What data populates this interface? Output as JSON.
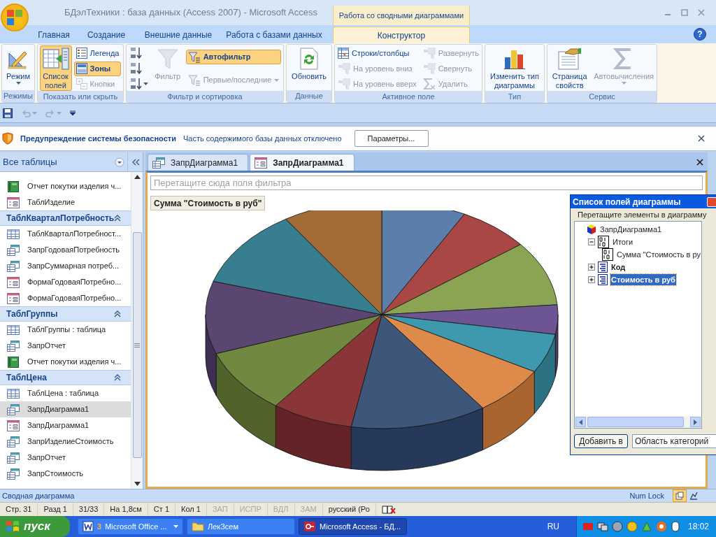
{
  "window": {
    "title": "БДэлТехники : база данных (Access 2007) - Microsoft Access"
  },
  "contextual_tab_group": "Работа со сводными диаграммами",
  "ribbon_tabs": [
    {
      "label": "Главная",
      "selected": false
    },
    {
      "label": "Создание",
      "selected": false
    },
    {
      "label": "Внешние данные",
      "selected": false
    },
    {
      "label": "Работа с базами данных",
      "selected": false
    },
    {
      "label": "Конструктор",
      "selected": true
    }
  ],
  "help_button": "?",
  "ribbon_groups": [
    {
      "label": "Режимы",
      "buttons": [
        {
          "label": "Режим",
          "kind": "large",
          "pressed": false,
          "disabled": false,
          "dropdown": true
        }
      ]
    },
    {
      "label": "Показать или скрыть",
      "buttons": [
        {
          "label": "Список полей",
          "kind": "large",
          "pressed": true,
          "disabled": false,
          "dropdown": false
        },
        {
          "label": "Легенда",
          "kind": "small",
          "pressed": false,
          "disabled": false,
          "dropdown": false
        },
        {
          "label": "Зоны",
          "kind": "small",
          "pressed": true,
          "disabled": false,
          "dropdown": false
        },
        {
          "label": "Кнопки",
          "kind": "small",
          "pressed": false,
          "disabled": true,
          "dropdown": false
        }
      ]
    },
    {
      "label": "Фильтр и сортировка",
      "buttons": [
        {
          "kind": "icon",
          "pressed": false,
          "disabled": false,
          "dropdown": false
        },
        {
          "kind": "icon",
          "pressed": false,
          "disabled": false,
          "dropdown": false
        },
        {
          "kind": "icon",
          "pressed": false,
          "disabled": false,
          "dropdown": true
        },
        {
          "label": "Фильтр",
          "kind": "large",
          "pressed": false,
          "disabled": true,
          "dropdown": false
        },
        {
          "label": "Автофильтр",
          "kind": "small",
          "pressed": true,
          "disabled": false,
          "dropdown": false
        },
        {
          "label": "Первые/последние",
          "kind": "small",
          "pressed": false,
          "disabled": true,
          "dropdown": true
        }
      ]
    },
    {
      "label": "Данные",
      "buttons": [
        {
          "label": "Обновить",
          "kind": "large",
          "pressed": false,
          "disabled": false,
          "dropdown": false
        }
      ]
    },
    {
      "label": "Активное поле",
      "buttons": [
        {
          "label": "Строки/столбцы",
          "kind": "small",
          "pressed": false,
          "disabled": false,
          "dropdown": false
        },
        {
          "label": "На уровень вниз",
          "kind": "small",
          "pressed": false,
          "disabled": true,
          "dropdown": false
        },
        {
          "label": "На уровень вверх",
          "kind": "small",
          "pressed": false,
          "disabled": true,
          "dropdown": false
        },
        {
          "label": "Развернуть",
          "kind": "small",
          "pressed": false,
          "disabled": true,
          "dropdown": false
        },
        {
          "label": "Свернуть",
          "kind": "small",
          "pressed": false,
          "disabled": true,
          "dropdown": false
        },
        {
          "label": "Удалить",
          "kind": "small",
          "pressed": false,
          "disabled": true,
          "dropdown": false
        }
      ]
    },
    {
      "label": "Тип",
      "buttons": [
        {
          "label": "Изменить тип диаграммы",
          "kind": "large",
          "pressed": false,
          "disabled": false,
          "dropdown": false
        }
      ]
    },
    {
      "label": "Сервис",
      "buttons": [
        {
          "label": "Страница свойств",
          "kind": "large",
          "pressed": false,
          "disabled": false,
          "dropdown": false
        },
        {
          "label": "Автовычисления",
          "kind": "large",
          "pressed": false,
          "disabled": true,
          "dropdown": true
        }
      ]
    }
  ],
  "quick_access": [
    {
      "kind": "save",
      "disabled": false
    },
    {
      "kind": "undo",
      "disabled": true
    },
    {
      "kind": "redo",
      "disabled": true
    },
    {
      "kind": "customize",
      "disabled": false
    }
  ],
  "security_bar": {
    "title": "Предупреждение системы безопасности",
    "message": "Часть содержимого базы данных отключено",
    "button": "Параметры..."
  },
  "navigation": {
    "title": "Все таблицы",
    "sections": [
      {
        "items": [
          {
            "label": "Отчет покутки изделия ч...",
            "kind": "report",
            "selected": false
          },
          {
            "label": "ТаблИзделие",
            "kind": "form",
            "selected": false
          }
        ]
      },
      {
        "header": "ТаблКварталПотребность",
        "expanded": true,
        "items": [
          {
            "label": "ТаблКварталПотребност...",
            "kind": "table",
            "selected": false
          },
          {
            "label": "ЗапрГодоваяПотребность",
            "kind": "query",
            "selected": false
          },
          {
            "label": "ЗапрСуммарная потреб...",
            "kind": "query",
            "selected": false
          },
          {
            "label": "ФормаГодоваяПотребно...",
            "kind": "form",
            "selected": false
          },
          {
            "label": "ФормаГодоваяПотребно...",
            "kind": "form",
            "selected": false
          }
        ]
      },
      {
        "header": "ТаблГруппы",
        "expanded": true,
        "items": [
          {
            "label": "ТаблГруппы : таблица",
            "kind": "table",
            "selected": false
          },
          {
            "label": "ЗапрОтчет",
            "kind": "query",
            "selected": false
          },
          {
            "label": "Отчет покутки изделия ч...",
            "kind": "report",
            "selected": false
          }
        ]
      },
      {
        "header": "ТаблЦена",
        "expanded": true,
        "items": [
          {
            "label": "ТаблЦена : таблица",
            "kind": "table",
            "selected": false
          },
          {
            "label": "ЗапрДиаграмма1",
            "kind": "query",
            "selected": true
          },
          {
            "label": "ЗапрДиаграмма1",
            "kind": "form",
            "selected": false
          },
          {
            "label": "ЗапрИзделиеСтоимость",
            "kind": "query",
            "selected": false
          },
          {
            "label": "ЗапрОтчет",
            "kind": "query",
            "selected": false
          },
          {
            "label": "ЗапрСтоимость",
            "kind": "query",
            "selected": false
          }
        ]
      }
    ]
  },
  "document_tabs": [
    {
      "label": "ЗапрДиаграмма1",
      "kind": "query",
      "selected": false
    },
    {
      "label": "ЗапрДиаграмма1",
      "kind": "form",
      "selected": true
    }
  ],
  "pivot_chart": {
    "filter_zone": {
      "placeholder": "Перетащите сюда поля фильтра"
    },
    "data_field": "Сумма \"Стоимость в руб\""
  },
  "field_list": {
    "title": "Список полей диаграммы",
    "hint": "Перетащите элементы в диаграмму",
    "tree": [
      {
        "label": "ЗапрДиаграмма1",
        "kind": "root",
        "selected": false,
        "children": [
          {
            "label": "Итоги",
            "kind": "totals",
            "expanded": true,
            "bold": false,
            "selected": false,
            "children": [
              {
                "label": "Сумма \"Стоимость в ру",
                "kind": "totals",
                "selected": false
              }
            ]
          },
          {
            "label": "Код",
            "kind": "field",
            "expanded": false,
            "bold": true,
            "selected": false
          },
          {
            "label": "Стоимость в руб",
            "kind": "field",
            "expanded": false,
            "bold": true,
            "selected": true
          }
        ]
      }
    ],
    "add_button": "Добавить в",
    "area_select": {
      "value": "Область категорий"
    }
  },
  "status_bar": {
    "left": "Сводная диаграмма",
    "right": "Num Lock"
  },
  "word_status_bar": [
    {
      "label": "Стр. 31",
      "disabled": false
    },
    {
      "label": "Разд 1",
      "disabled": false
    },
    {
      "label": "31/33",
      "disabled": false
    },
    {
      "label": "На 1,8см",
      "disabled": false
    },
    {
      "label": "Ст 1",
      "disabled": false
    },
    {
      "label": "Кол 1",
      "disabled": false
    },
    {
      "label": "ЗАП",
      "disabled": true
    },
    {
      "label": "ИСПР",
      "disabled": true
    },
    {
      "label": "ВДЛ",
      "disabled": true
    },
    {
      "label": "ЗАМ",
      "disabled": true
    },
    {
      "label": "русский (Ро",
      "disabled": false
    }
  ],
  "taskbar": {
    "start": "пуск",
    "tasks": [
      {
        "count": "3",
        "label": "Microsoft Office ...",
        "kind": "word",
        "selected": false,
        "dropdown": true
      },
      {
        "label": "ЛекЗсем",
        "kind": "folder",
        "selected": false,
        "dropdown": false
      },
      {
        "label": "Microsoft Access - БД...",
        "kind": "access",
        "selected": true,
        "dropdown": false
      }
    ],
    "language": "RU",
    "clock": "18:02"
  }
}
